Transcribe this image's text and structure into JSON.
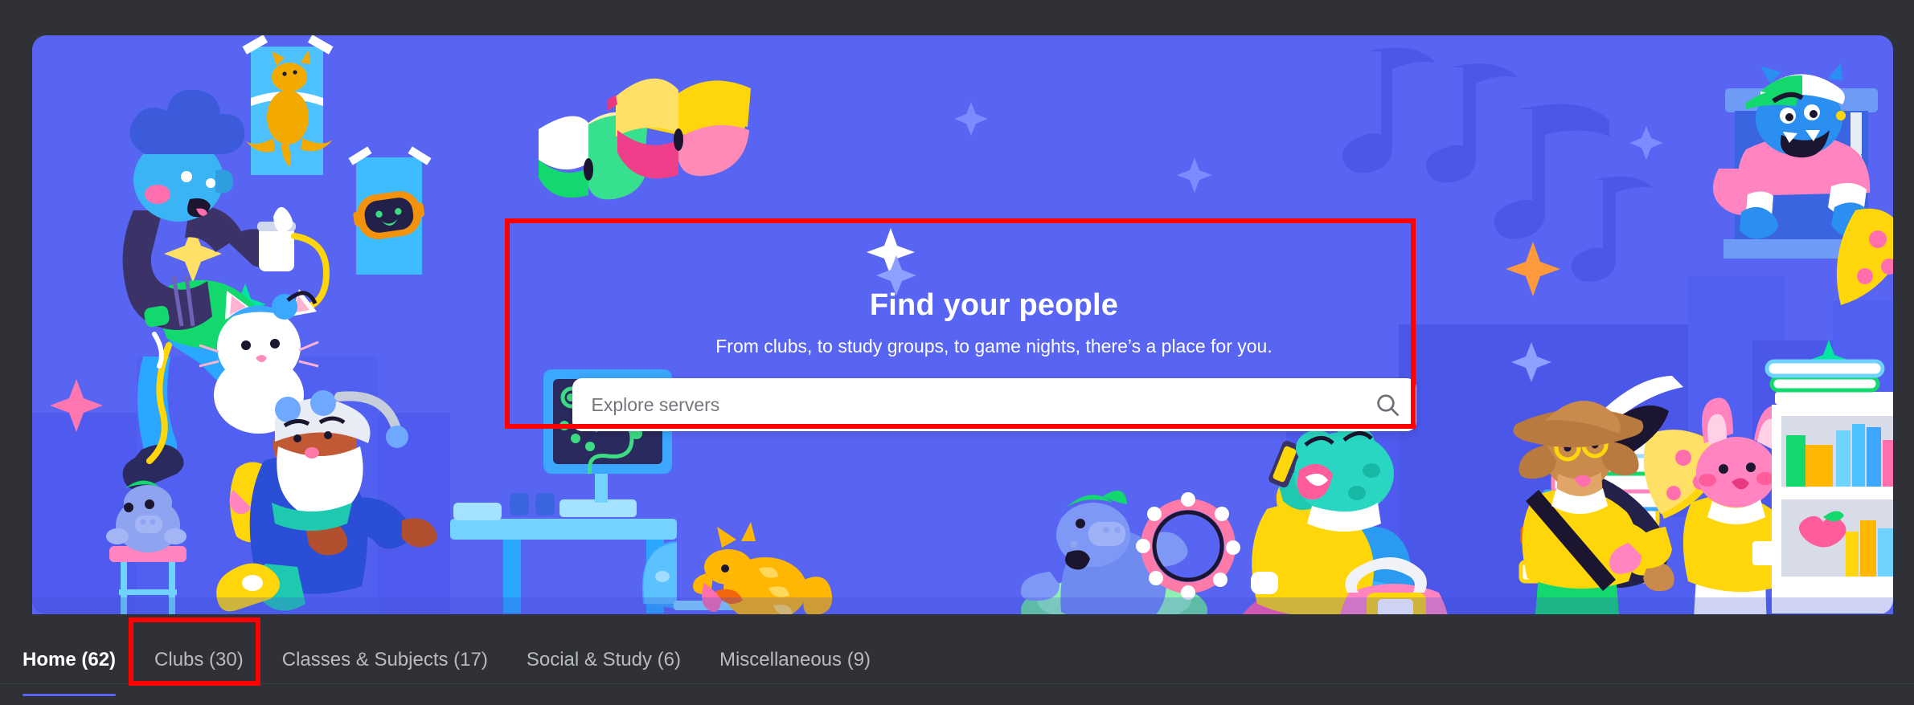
{
  "theme": {
    "app_bg": "#2F3136",
    "banner_bg": "#5865F2",
    "accent": "#5865F2",
    "annotation": "#FF0000",
    "text_primary": "#FFFFFF",
    "text_muted": "#B9BBBE"
  },
  "banner": {
    "heading": "Find your people",
    "subheading": "From clubs, to study groups, to game nights, there’s a place for you.",
    "search": {
      "placeholder": "Explore servers",
      "value": "",
      "icon": "search-icon"
    },
    "illustration": {
      "description": "Discord server discovery illustration with cartoon characters in a dorm/common room",
      "elements": [
        "character-with-noodles-on-steps",
        "cat-poster",
        "clyde-robot-poster",
        "white-cat-character",
        "character-at-gaming-desk",
        "wumpus-figurine-on-stool",
        "orange-cat-at-laptop",
        "blue-wumpus-with-tambourine",
        "green-frog-on-armchair",
        "pink-backpack",
        "dog-with-cowboy-hat-and-guitar",
        "book-stack",
        "pizza-slices",
        "flying-books",
        "music-notes",
        "monster-in-window",
        "pink-bunny-character",
        "white-bookshelf-with-apple"
      ]
    }
  },
  "tabs": [
    {
      "label": "Home (62)",
      "name": "home",
      "count": 62,
      "active": true
    },
    {
      "label": "Clubs (30)",
      "name": "clubs",
      "count": 30,
      "active": false
    },
    {
      "label": "Classes & Subjects (17)",
      "name": "classes-subjects",
      "count": 17,
      "active": false
    },
    {
      "label": "Social & Study (6)",
      "name": "social-study",
      "count": 6,
      "active": false
    },
    {
      "label": "Miscellaneous (9)",
      "name": "miscellaneous",
      "count": 9,
      "active": false
    }
  ],
  "annotations": [
    {
      "target": "search-hero-card",
      "color": "#FF0000"
    },
    {
      "target": "tab-clubs",
      "color": "#FF0000"
    }
  ]
}
